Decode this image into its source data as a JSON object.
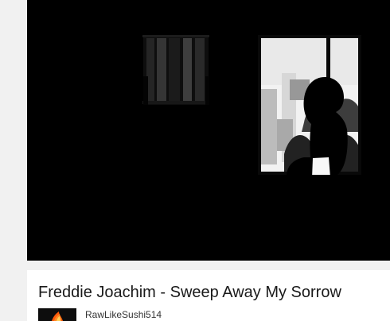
{
  "video": {
    "title": "Freddie Joachim - Sweep Away My Sorrow",
    "thumbnail_icon": "video-frame"
  },
  "channel": {
    "name": "RawLikeSushi514",
    "avatar_icon": "avatar-icon"
  },
  "colors": {
    "page_background": "#f1f1f1",
    "player_background": "#000000",
    "card_background": "#ffffff",
    "title_text": "#1a1a1a",
    "channel_text": "#333333"
  }
}
